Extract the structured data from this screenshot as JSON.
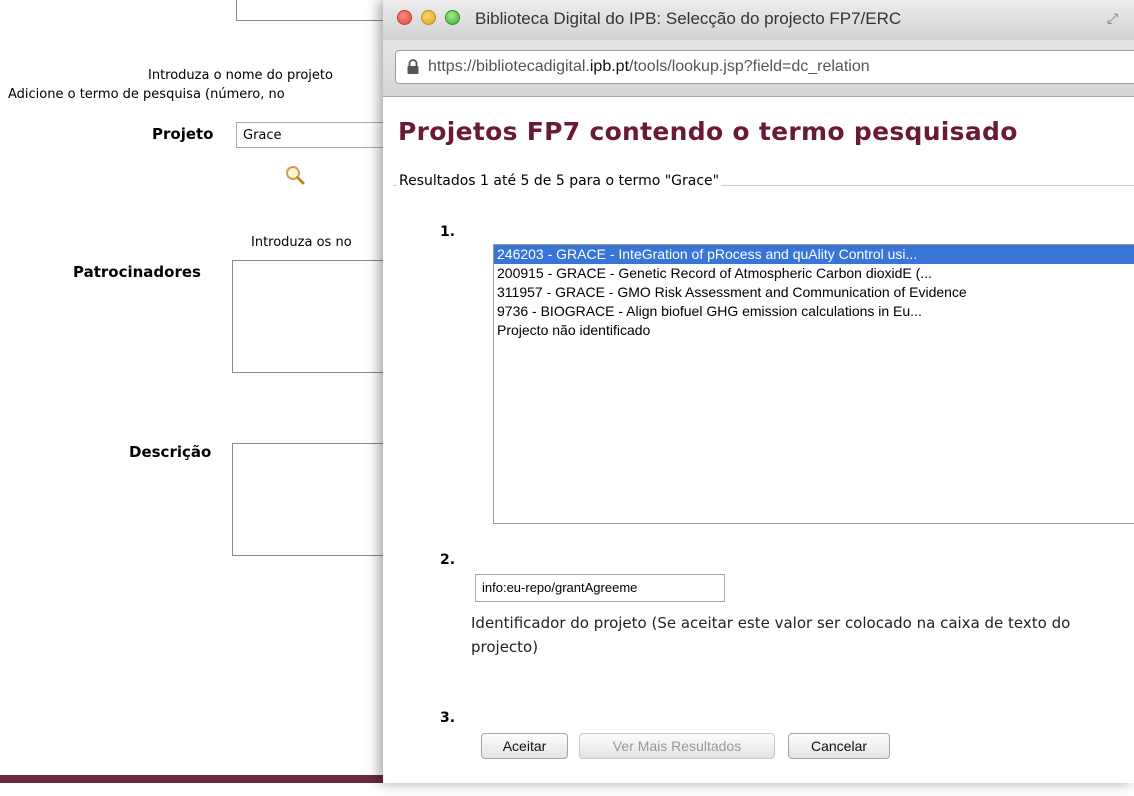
{
  "background_form": {
    "intro_project_text": "Introduza o nome do projeto",
    "add_search_term_text": "Adicione o termo de pesquisa (número, no",
    "projeto_label": "Projeto",
    "projeto_value": "Grace",
    "sponsors_intro_text": "Introduza os no",
    "patrocinadores_label": "Patrocinadores",
    "descricao_label": "Descrição"
  },
  "popup": {
    "window_title": "Biblioteca Digital do IPB: Selecção do projecto FP7/ERC",
    "url_prefix": "https://bibliotecadigital.",
    "url_domain": "ipb.pt",
    "url_path": "/tools/lookup.jsp?field=dc_relation",
    "heading": "Projetos FP7 contendo o termo pesquisado",
    "results_legend": "Resultados 1 até 5 de 5 para o termo \"Grace\"",
    "step1": "1.",
    "step2": "2.",
    "step3": "3.",
    "results": [
      "246203 - GRACE - InteGration of pRocess and quAlity Control usi...",
      "200915 - GRACE - Genetic Record of Atmospheric Carbon dioxidE (...",
      "311957 - GRACE - GMO Risk Assessment and Communication of Evidence",
      "9736 - BIOGRACE - Align biofuel GHG emission calculations in Eu...",
      "Projecto não identificado"
    ],
    "selected_index": 0,
    "identifier_value": "info:eu-repo/grantAgreeme",
    "identifier_hint": "Identificador do projeto (Se aceitar este valor ser colocado na caixa de texto do projecto)",
    "buttons": {
      "accept": "Aceitar",
      "more_results": "Ver Mais Resultados",
      "cancel": "Cancelar"
    }
  },
  "colors": {
    "heading": "#6b1a36",
    "selection": "#3875d7"
  }
}
